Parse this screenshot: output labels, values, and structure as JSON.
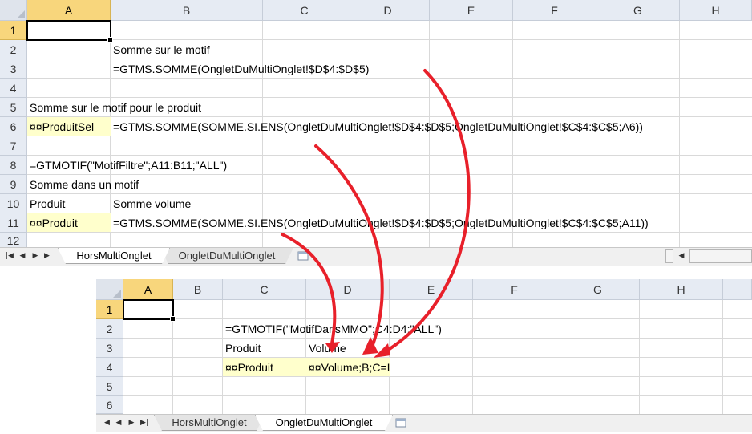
{
  "sheet1": {
    "columns": [
      "A",
      "B",
      "C",
      "D",
      "E",
      "F",
      "G",
      "H"
    ],
    "rows": [
      "1",
      "2",
      "3",
      "4",
      "5",
      "6",
      "7",
      "8",
      "9",
      "10",
      "11",
      "12"
    ],
    "cells": {
      "b2": "Somme sur le motif",
      "b3": "=GTMS.SOMME(OngletDuMultiOnglet!$D$4:$D$5)",
      "a5": "Somme sur le motif pour le produit",
      "a6": "¤¤ProduitSel",
      "b6": "=GTMS.SOMME(SOMME.SI.ENS(OngletDuMultiOnglet!$D$4:$D$5;OngletDuMultiOnglet!$C$4:$C$5;A6))",
      "a8": "=GTMOTIF(\"MotifFiltre\";A11:B11;\"ALL\")",
      "a9": "Somme dans un motif",
      "a10": "Produit",
      "b10": "Somme volume",
      "a11": "¤¤Produit",
      "b11": "=GTMS.SOMME(SOMME.SI.ENS(OngletDuMultiOnglet!$D$4:$D$5;OngletDuMultiOnglet!$C$4:$C$5;A11))"
    },
    "tabs": [
      "HorsMultiOnglet",
      "OngletDuMultiOnglet"
    ],
    "active_tab": "HorsMultiOnglet"
  },
  "sheet2": {
    "columns": [
      "A",
      "B",
      "C",
      "D",
      "E",
      "F",
      "G",
      "H"
    ],
    "rows": [
      "1",
      "2",
      "3",
      "4",
      "5",
      "6"
    ],
    "cells": {
      "c2": "=GTMOTIF(\"MotifDansMMO\";C4:D4;\"ALL\")",
      "c3": "Produit",
      "d3": "Volume",
      "c4": "¤¤Produit",
      "d4": "¤¤Volume;B;C=I"
    },
    "tabs": [
      "HorsMultiOnglet",
      "OngletDuMultiOnglet"
    ],
    "active_tab": "OngletDuMultiOnglet"
  },
  "colors": {
    "header_bg": "#e6ebf3",
    "selected_header": "#f8d67c",
    "highlight_cell": "#ffffcc",
    "arrow": "#e8202a"
  },
  "nav_icons": [
    "first-sheet-icon",
    "prev-sheet-icon",
    "next-sheet-icon",
    "last-sheet-icon"
  ]
}
